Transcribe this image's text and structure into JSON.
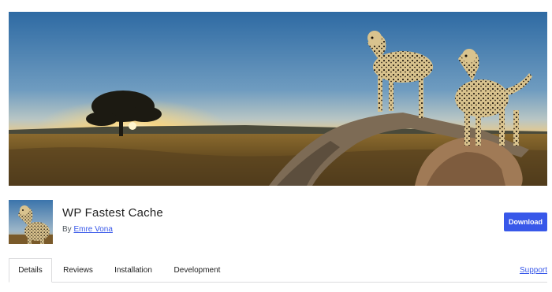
{
  "plugin": {
    "title": "WP Fastest Cache",
    "by_label": "By",
    "author": "Emre Vona",
    "download_label": "Download"
  },
  "tabs": [
    {
      "label": "Details",
      "active": true
    },
    {
      "label": "Reviews",
      "active": false
    },
    {
      "label": "Installation",
      "active": false
    },
    {
      "label": "Development",
      "active": false
    }
  ],
  "support_label": "Support",
  "colors": {
    "accent": "#3858e9",
    "text": "#1e1e1e",
    "muted": "#50575e",
    "border": "#dcdcde"
  }
}
